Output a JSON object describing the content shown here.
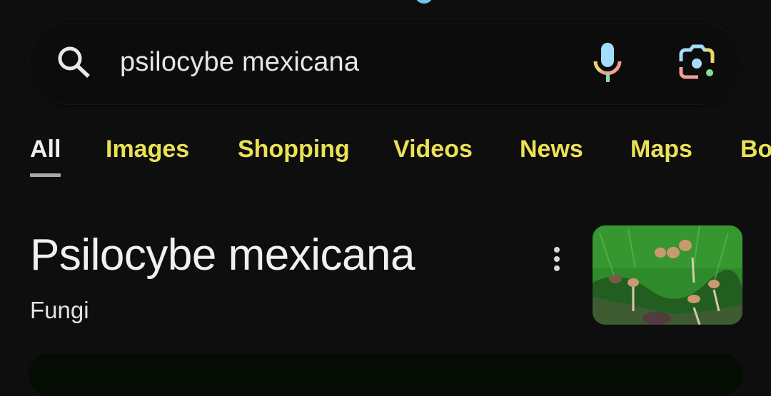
{
  "search": {
    "query": "psilocybe mexicana",
    "icons": [
      "search-icon",
      "mic-icon",
      "google-lens-icon"
    ]
  },
  "tabs": [
    {
      "label": "All",
      "active": true
    },
    {
      "label": "Images"
    },
    {
      "label": "Shopping"
    },
    {
      "label": "Videos"
    },
    {
      "label": "News"
    },
    {
      "label": "Maps"
    },
    {
      "label": "Bo"
    }
  ],
  "knowledge_panel": {
    "title": "Psilocybe mexicana",
    "subtitle": "Fungi",
    "menu_icon": "more-vert-icon",
    "thumbnail_alt": "mushrooms in grass"
  },
  "colors": {
    "background": "#0e0e0e",
    "tab_text": "#ebe154",
    "active_tab_text": "#eeeeee",
    "mic_blue": "#a6dcfb",
    "mic_yellow": "#ecd66a",
    "mic_red": "#f0a195",
    "mic_green": "#7fe39a"
  }
}
